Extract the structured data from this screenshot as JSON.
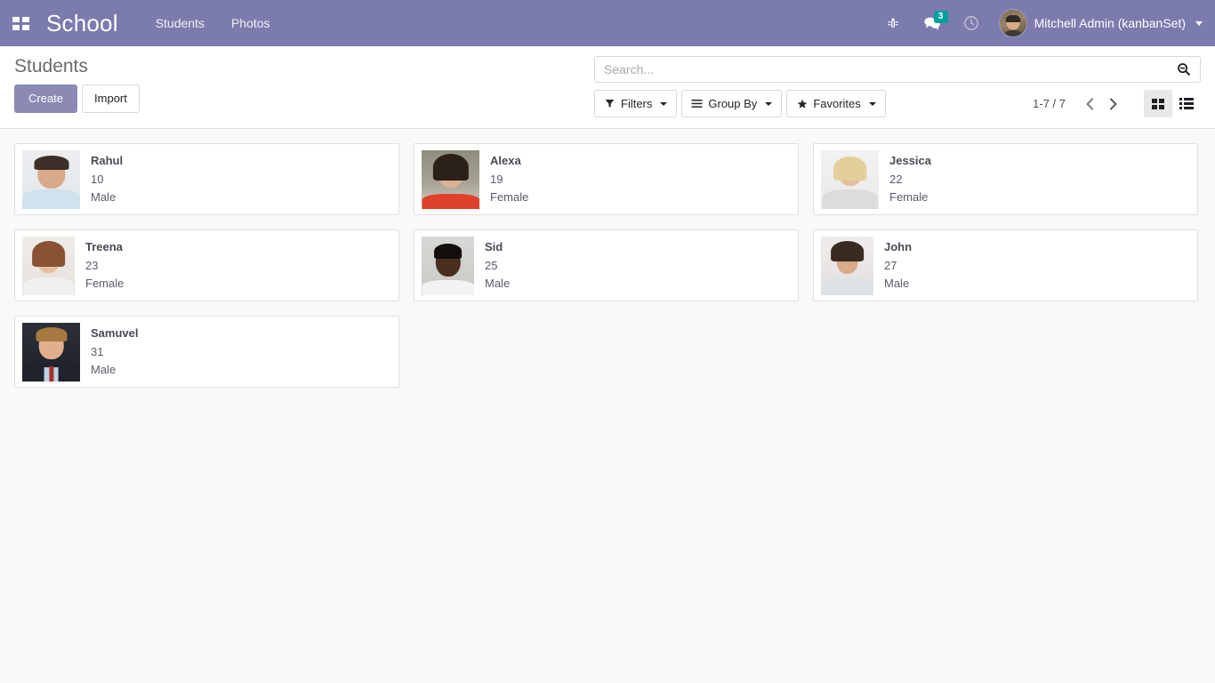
{
  "navbar": {
    "apps_icon": "apps-grid-icon",
    "brand": "School",
    "menu_items": [
      {
        "label": "Students"
      },
      {
        "label": "Photos"
      }
    ],
    "icons": [
      {
        "name": "bug-icon"
      },
      {
        "name": "messages-icon",
        "badge": "3"
      },
      {
        "name": "activities-clock-icon"
      }
    ],
    "user": {
      "name": "Mitchell Admin (kanbanSet)",
      "avatar": "user-avatar"
    },
    "background_color": "#7c7bad",
    "badge_color": "#00a09d"
  },
  "control_panel": {
    "title": "Students",
    "create_label": "Create",
    "import_label": "Import",
    "create_color": "#8a8ab5",
    "search": {
      "placeholder": "Search...",
      "value": "",
      "icon": "search-icon"
    },
    "filters": [
      {
        "label": "Filters",
        "icon": "filter-funnel-icon"
      },
      {
        "label": "Group By",
        "icon": "group-lines-icon"
      },
      {
        "label": "Favorites",
        "icon": "star-icon"
      }
    ],
    "pager": {
      "value": "1-7 / 7",
      "previous_icon": "chevron-left-icon",
      "next_icon": "chevron-right-icon"
    },
    "view_switcher": [
      {
        "name": "kanban-view",
        "icon": "kanban-grid-icon",
        "active": true
      },
      {
        "name": "list-view",
        "icon": "list-icon",
        "active": false
      }
    ]
  },
  "kanban": {
    "cards": [
      {
        "name": "Rahul",
        "age": "10",
        "gender": "Male",
        "photo": "p-rahul"
      },
      {
        "name": "Alexa",
        "age": "19",
        "gender": "Female",
        "photo": "p-alexa"
      },
      {
        "name": "Jessica",
        "age": "22",
        "gender": "Female",
        "photo": "p-jessica"
      },
      {
        "name": "Treena",
        "age": "23",
        "gender": "Female",
        "photo": "p-treena"
      },
      {
        "name": "Sid",
        "age": "25",
        "gender": "Male",
        "photo": "p-sid"
      },
      {
        "name": "John",
        "age": "27",
        "gender": "Male",
        "photo": "p-john"
      },
      {
        "name": "Samuvel",
        "age": "31",
        "gender": "Male",
        "photo": "p-samuvel"
      }
    ]
  }
}
